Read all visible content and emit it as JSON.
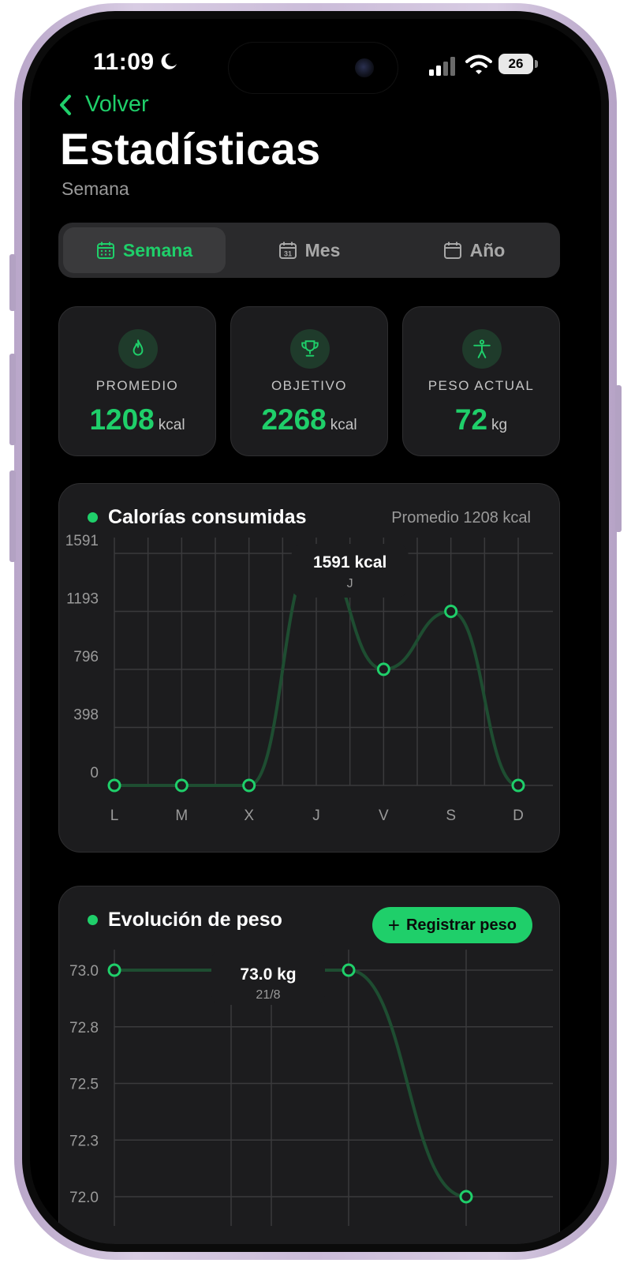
{
  "status_bar": {
    "time": "11:09",
    "battery": "26"
  },
  "header": {
    "back_label": "Volver",
    "title": "Estadísticas",
    "subtitle": "Semana"
  },
  "segments": [
    {
      "label": "Semana",
      "icon": "calendar-grid-icon",
      "active": true
    },
    {
      "label": "Mes",
      "icon": "calendar-31-icon",
      "active": false
    },
    {
      "label": "Año",
      "icon": "calendar-icon",
      "active": false
    }
  ],
  "stats": [
    {
      "label": "PROMEDIO",
      "value": "1208",
      "unit": "kcal",
      "icon": "flame-icon"
    },
    {
      "label": "OBJETIVO",
      "value": "2268",
      "unit": "kcal",
      "icon": "trophy-icon"
    },
    {
      "label": "PESO ACTUAL",
      "value": "72",
      "unit": "kg",
      "icon": "person-icon"
    }
  ],
  "colors": {
    "accent": "#1fcf6a",
    "background": "#000000",
    "card": "#1c1c1e",
    "line": "#1e4d31"
  },
  "calories_card": {
    "title": "Calorías consumidas",
    "meta": "Promedio 1208 kcal"
  },
  "weight_card": {
    "title": "Evolución de peso",
    "button_label": "Registrar peso"
  },
  "chart_data": [
    {
      "type": "line",
      "title": "Calorías consumidas",
      "categories": [
        "L",
        "M",
        "X",
        "J",
        "V",
        "S",
        "D"
      ],
      "values": [
        0,
        0,
        0,
        1591,
        796,
        1193,
        0
      ],
      "y_ticks": [
        "1591",
        "1193",
        "796",
        "398",
        "0"
      ],
      "ylim": [
        0,
        1591
      ],
      "grid": true,
      "tooltip": {
        "value": "1591 kcal",
        "label": "J"
      }
    },
    {
      "type": "line",
      "title": "Evolución de peso",
      "values": [
        73.0,
        73.0,
        72.0
      ],
      "y_ticks": [
        "73.0",
        "72.8",
        "72.5",
        "72.3",
        "72.0"
      ],
      "ylim": [
        72.0,
        73.0
      ],
      "grid": true,
      "tooltip": {
        "value": "73.0 kg",
        "label": "21/8"
      }
    }
  ]
}
